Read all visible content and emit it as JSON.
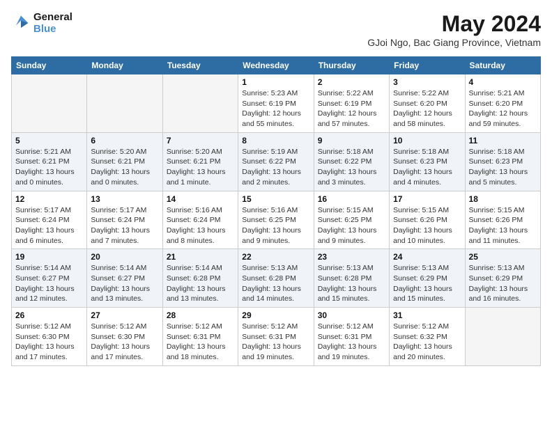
{
  "logo": {
    "line1": "General",
    "line2": "Blue"
  },
  "title": {
    "month_year": "May 2024",
    "location": "GJoi Ngo, Bac Giang Province, Vietnam"
  },
  "headers": [
    "Sunday",
    "Monday",
    "Tuesday",
    "Wednesday",
    "Thursday",
    "Friday",
    "Saturday"
  ],
  "weeks": [
    [
      {
        "day": "",
        "info": ""
      },
      {
        "day": "",
        "info": ""
      },
      {
        "day": "",
        "info": ""
      },
      {
        "day": "1",
        "info": "Sunrise: 5:23 AM\nSunset: 6:19 PM\nDaylight: 12 hours and 55 minutes."
      },
      {
        "day": "2",
        "info": "Sunrise: 5:22 AM\nSunset: 6:19 PM\nDaylight: 12 hours and 57 minutes."
      },
      {
        "day": "3",
        "info": "Sunrise: 5:22 AM\nSunset: 6:20 PM\nDaylight: 12 hours and 58 minutes."
      },
      {
        "day": "4",
        "info": "Sunrise: 5:21 AM\nSunset: 6:20 PM\nDaylight: 12 hours and 59 minutes."
      }
    ],
    [
      {
        "day": "5",
        "info": "Sunrise: 5:21 AM\nSunset: 6:21 PM\nDaylight: 13 hours and 0 minutes."
      },
      {
        "day": "6",
        "info": "Sunrise: 5:20 AM\nSunset: 6:21 PM\nDaylight: 13 hours and 0 minutes."
      },
      {
        "day": "7",
        "info": "Sunrise: 5:20 AM\nSunset: 6:21 PM\nDaylight: 13 hours and 1 minute."
      },
      {
        "day": "8",
        "info": "Sunrise: 5:19 AM\nSunset: 6:22 PM\nDaylight: 13 hours and 2 minutes."
      },
      {
        "day": "9",
        "info": "Sunrise: 5:18 AM\nSunset: 6:22 PM\nDaylight: 13 hours and 3 minutes."
      },
      {
        "day": "10",
        "info": "Sunrise: 5:18 AM\nSunset: 6:23 PM\nDaylight: 13 hours and 4 minutes."
      },
      {
        "day": "11",
        "info": "Sunrise: 5:18 AM\nSunset: 6:23 PM\nDaylight: 13 hours and 5 minutes."
      }
    ],
    [
      {
        "day": "12",
        "info": "Sunrise: 5:17 AM\nSunset: 6:24 PM\nDaylight: 13 hours and 6 minutes."
      },
      {
        "day": "13",
        "info": "Sunrise: 5:17 AM\nSunset: 6:24 PM\nDaylight: 13 hours and 7 minutes."
      },
      {
        "day": "14",
        "info": "Sunrise: 5:16 AM\nSunset: 6:24 PM\nDaylight: 13 hours and 8 minutes."
      },
      {
        "day": "15",
        "info": "Sunrise: 5:16 AM\nSunset: 6:25 PM\nDaylight: 13 hours and 9 minutes."
      },
      {
        "day": "16",
        "info": "Sunrise: 5:15 AM\nSunset: 6:25 PM\nDaylight: 13 hours and 9 minutes."
      },
      {
        "day": "17",
        "info": "Sunrise: 5:15 AM\nSunset: 6:26 PM\nDaylight: 13 hours and 10 minutes."
      },
      {
        "day": "18",
        "info": "Sunrise: 5:15 AM\nSunset: 6:26 PM\nDaylight: 13 hours and 11 minutes."
      }
    ],
    [
      {
        "day": "19",
        "info": "Sunrise: 5:14 AM\nSunset: 6:27 PM\nDaylight: 13 hours and 12 minutes."
      },
      {
        "day": "20",
        "info": "Sunrise: 5:14 AM\nSunset: 6:27 PM\nDaylight: 13 hours and 13 minutes."
      },
      {
        "day": "21",
        "info": "Sunrise: 5:14 AM\nSunset: 6:28 PM\nDaylight: 13 hours and 13 minutes."
      },
      {
        "day": "22",
        "info": "Sunrise: 5:13 AM\nSunset: 6:28 PM\nDaylight: 13 hours and 14 minutes."
      },
      {
        "day": "23",
        "info": "Sunrise: 5:13 AM\nSunset: 6:28 PM\nDaylight: 13 hours and 15 minutes."
      },
      {
        "day": "24",
        "info": "Sunrise: 5:13 AM\nSunset: 6:29 PM\nDaylight: 13 hours and 15 minutes."
      },
      {
        "day": "25",
        "info": "Sunrise: 5:13 AM\nSunset: 6:29 PM\nDaylight: 13 hours and 16 minutes."
      }
    ],
    [
      {
        "day": "26",
        "info": "Sunrise: 5:12 AM\nSunset: 6:30 PM\nDaylight: 13 hours and 17 minutes."
      },
      {
        "day": "27",
        "info": "Sunrise: 5:12 AM\nSunset: 6:30 PM\nDaylight: 13 hours and 17 minutes."
      },
      {
        "day": "28",
        "info": "Sunrise: 5:12 AM\nSunset: 6:31 PM\nDaylight: 13 hours and 18 minutes."
      },
      {
        "day": "29",
        "info": "Sunrise: 5:12 AM\nSunset: 6:31 PM\nDaylight: 13 hours and 19 minutes."
      },
      {
        "day": "30",
        "info": "Sunrise: 5:12 AM\nSunset: 6:31 PM\nDaylight: 13 hours and 19 minutes."
      },
      {
        "day": "31",
        "info": "Sunrise: 5:12 AM\nSunset: 6:32 PM\nDaylight: 13 hours and 20 minutes."
      },
      {
        "day": "",
        "info": ""
      }
    ]
  ]
}
